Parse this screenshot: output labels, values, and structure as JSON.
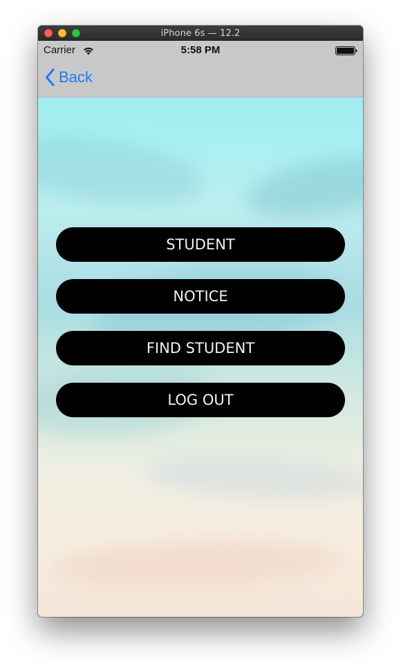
{
  "window": {
    "title": "iPhone 6s — 12.2"
  },
  "status_bar": {
    "carrier": "Carrier",
    "time": "5:58 PM",
    "wifi_icon": "wifi-icon",
    "battery_icon": "battery-icon"
  },
  "nav": {
    "back_label": "Back",
    "back_icon": "chevron-left-icon",
    "accent_color": "#1a7cf3"
  },
  "menu": {
    "buttons": [
      {
        "label": "STUDENT"
      },
      {
        "label": "NOTICE"
      },
      {
        "label": "FIND STUDENT"
      },
      {
        "label": "LOG OUT"
      }
    ]
  }
}
